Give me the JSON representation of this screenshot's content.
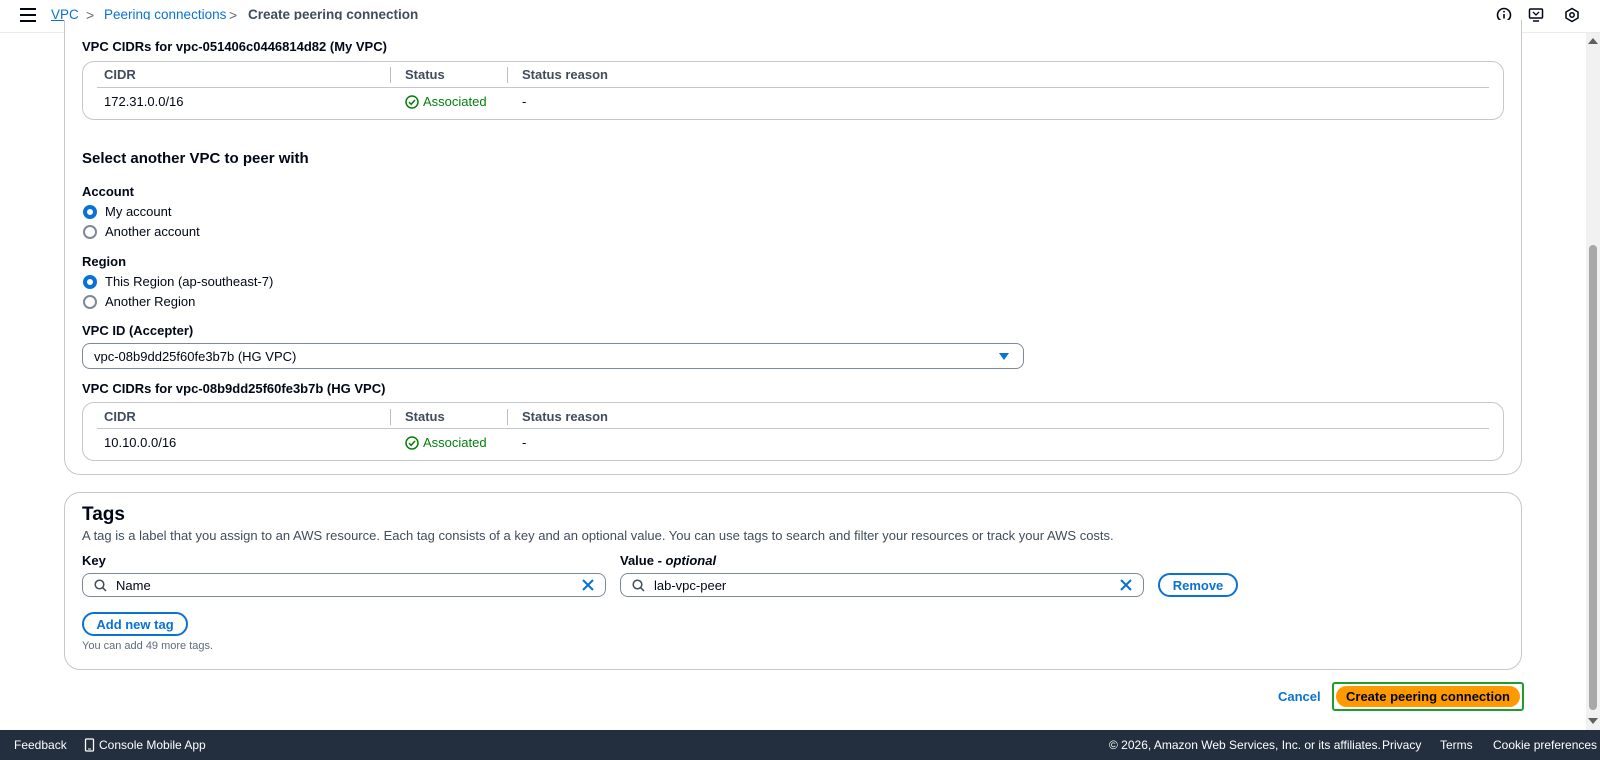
{
  "breadcrumb": {
    "items": [
      "VPC",
      "Peering connections"
    ],
    "current": "Create peering connection",
    "separator": ">"
  },
  "requester_cidrs": {
    "title": "VPC CIDRs for vpc-051406c0446814d82 (My VPC)",
    "columns": [
      "CIDR",
      "Status",
      "Status reason"
    ],
    "rows": [
      {
        "cidr": "172.31.0.0/16",
        "status": "Associated",
        "reason": "-"
      }
    ]
  },
  "peer_section": {
    "title": "Select another VPC to peer with",
    "account_label": "Account",
    "account_options": [
      "My account",
      "Another account"
    ],
    "account_selected": "My account",
    "region_label": "Region",
    "region_options": [
      "This Region (ap-southeast-7)",
      "Another Region"
    ],
    "region_selected": "This Region (ap-southeast-7)",
    "vpc_id_label": "VPC ID (Accepter)",
    "vpc_id_value": "vpc-08b9dd25f60fe3b7b (HG VPC)"
  },
  "accepter_cidrs": {
    "title": "VPC CIDRs for vpc-08b9dd25f60fe3b7b (HG VPC)",
    "columns": [
      "CIDR",
      "Status",
      "Status reason"
    ],
    "rows": [
      {
        "cidr": "10.10.0.0/16",
        "status": "Associated",
        "reason": "-"
      }
    ]
  },
  "tags": {
    "title": "Tags",
    "description": "A tag is a label that you assign to an AWS resource. Each tag consists of a key and an optional value. You can use tags to search and filter your resources or track your AWS costs.",
    "key_label": "Key",
    "value_label": "Value - ",
    "value_optional": "optional",
    "key_value": "Name",
    "value_value": "lab-vpc-peer",
    "remove_label": "Remove",
    "add_label": "Add new tag",
    "note": "You can add 49 more tags."
  },
  "actions": {
    "cancel": "Cancel",
    "create": "Create peering connection"
  },
  "footer": {
    "feedback": "Feedback",
    "mobile_app": "Console Mobile App",
    "copyright": "© 2026, Amazon Web Services, Inc. or its affiliates.",
    "privacy": "Privacy",
    "terms": "Terms",
    "cookies": "Cookie preferences"
  },
  "colors": {
    "link": "#0972d3",
    "success": "#037f0c",
    "primary_button": "#ff9900",
    "footer_bg": "#232f3e"
  }
}
